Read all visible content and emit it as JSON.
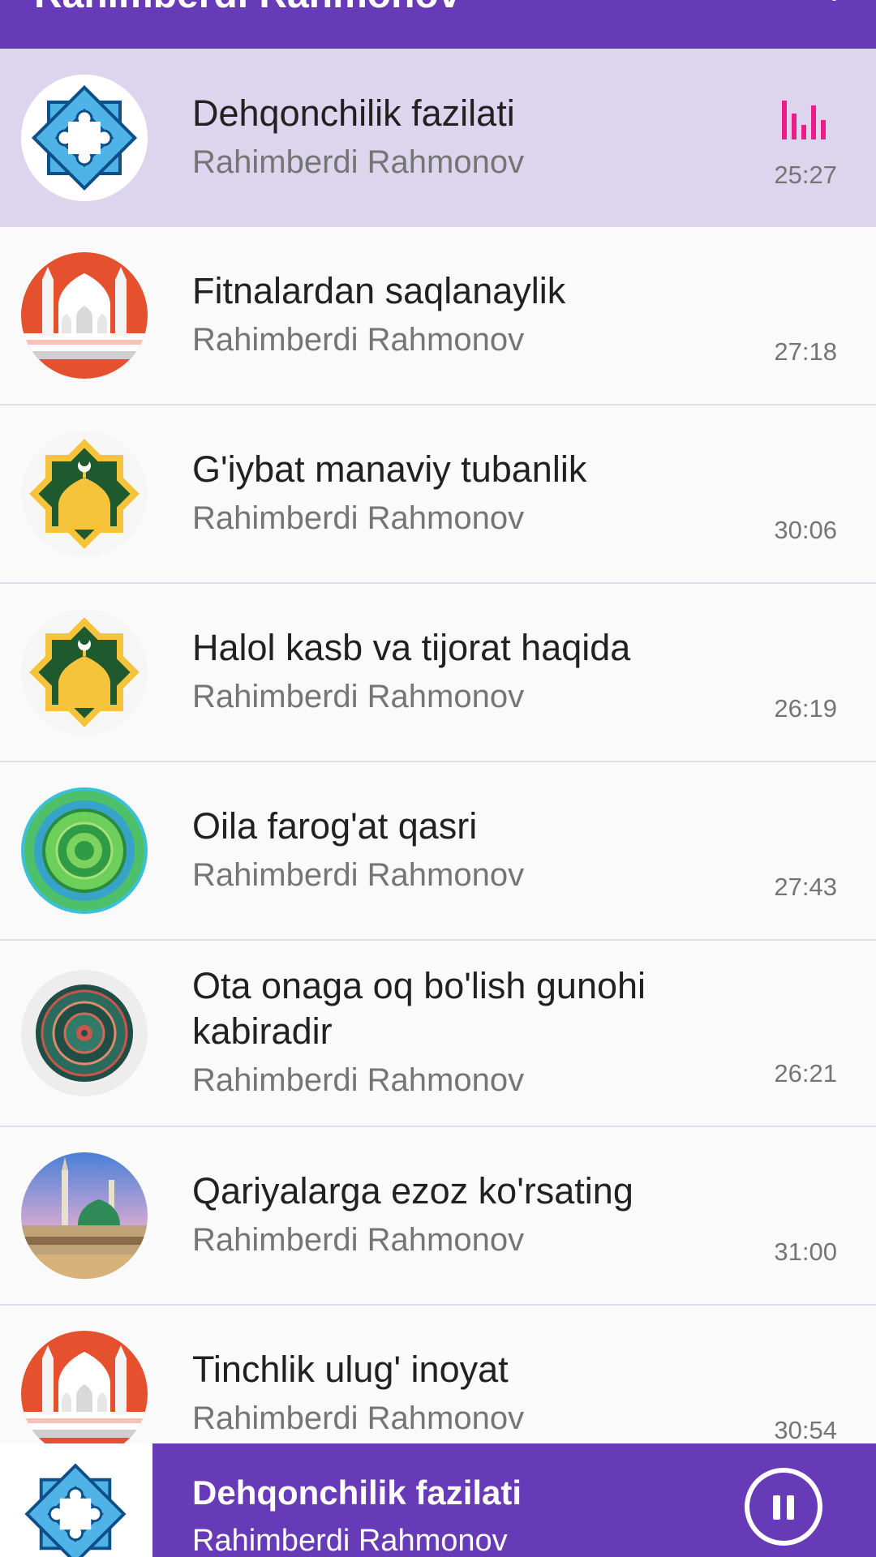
{
  "appbar": {
    "title": "Rahimberdi Rahmonov",
    "menu_icon": "more-vert-icon"
  },
  "colors": {
    "primary": "#673ab7",
    "active_row": "#ddd4ed",
    "eq_accent": "#e91e8c"
  },
  "tracks": [
    {
      "title": "Dehqonchilik fazilati",
      "artist": "Rahimberdi Rahmonov",
      "duration": "25:27",
      "art": "star-ornament",
      "playing": true
    },
    {
      "title": "Fitnalardan saqlanaylik",
      "artist": "Rahimberdi Rahmonov",
      "duration": "27:18",
      "art": "mosque-red"
    },
    {
      "title": "G'iybat manaviy tubanlik",
      "artist": "Rahimberdi Rahmonov",
      "duration": "30:06",
      "art": "mosque-star-green"
    },
    {
      "title": "Halol kasb va tijorat haqida",
      "artist": "Rahimberdi Rahmonov",
      "duration": "26:19",
      "art": "mosque-star-green"
    },
    {
      "title": "Oila farog'at qasri",
      "artist": "Rahimberdi Rahmonov",
      "duration": "27:43",
      "art": "mandala-blue-green"
    },
    {
      "title": "Ota onaga oq bo'lish gunohi kabiradir",
      "artist": "Rahimberdi Rahmonov",
      "duration": "26:21",
      "art": "mandala-dark"
    },
    {
      "title": "Qariyalarga ezoz ko'rsating",
      "artist": "Rahimberdi Rahmonov",
      "duration": "31:00",
      "art": "mosque-photo"
    },
    {
      "title": "Tinchlik ulug' inoyat",
      "artist": "Rahimberdi Rahmonov",
      "duration": "30:54",
      "art": "mosque-red"
    }
  ],
  "player": {
    "title": "Dehqonchilik fazilati",
    "artist": "Rahimberdi Rahmonov",
    "art": "star-ornament",
    "control_icon": "pause-icon"
  }
}
